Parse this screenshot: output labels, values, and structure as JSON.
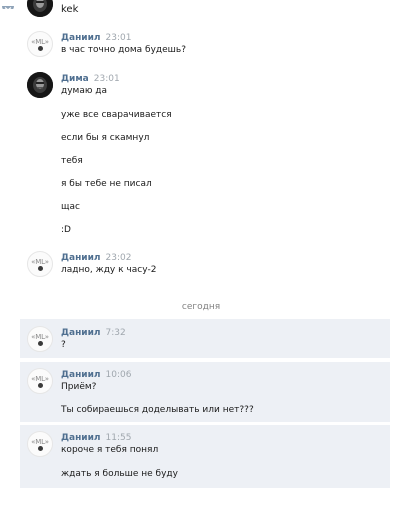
{
  "messages_top": {
    "first": {
      "text": "kek"
    },
    "m1": {
      "sender": "Даниил",
      "time": "23:01",
      "lines": [
        "в час точно дома будешь?"
      ]
    },
    "m2": {
      "sender": "Дима",
      "time": "23:01",
      "lines": [
        "думаю да",
        "уже все сварачивается",
        "если бы я скамнул",
        "тебя",
        "я бы тебе не писал",
        "щас",
        ":D"
      ]
    },
    "m3": {
      "sender": "Даниил",
      "time": "23:02",
      "lines": [
        "ладно, жду к часу-2"
      ]
    }
  },
  "day_separator": "сегодня",
  "messages_today": {
    "m4": {
      "sender": "Даниил",
      "time": "7:32",
      "lines": [
        "?"
      ]
    },
    "m5": {
      "sender": "Даниил",
      "time": "10:06",
      "lines": [
        "Приём?",
        "Ты собираешься доделывать или нет???"
      ]
    },
    "m6": {
      "sender": "Даниил",
      "time": "11:55",
      "lines": [
        "короче я тебя понял",
        "ждать я больше не буду"
      ]
    }
  },
  "avatar_ml_label": "«ML»",
  "colors": {
    "sender_name": "#4f6f90",
    "timestamp": "#a0a7ae",
    "unread_background": "#edf0f5",
    "message_text": "#1a1a1a"
  },
  "icons": {
    "scroll_top": "chevron-down-icon"
  }
}
